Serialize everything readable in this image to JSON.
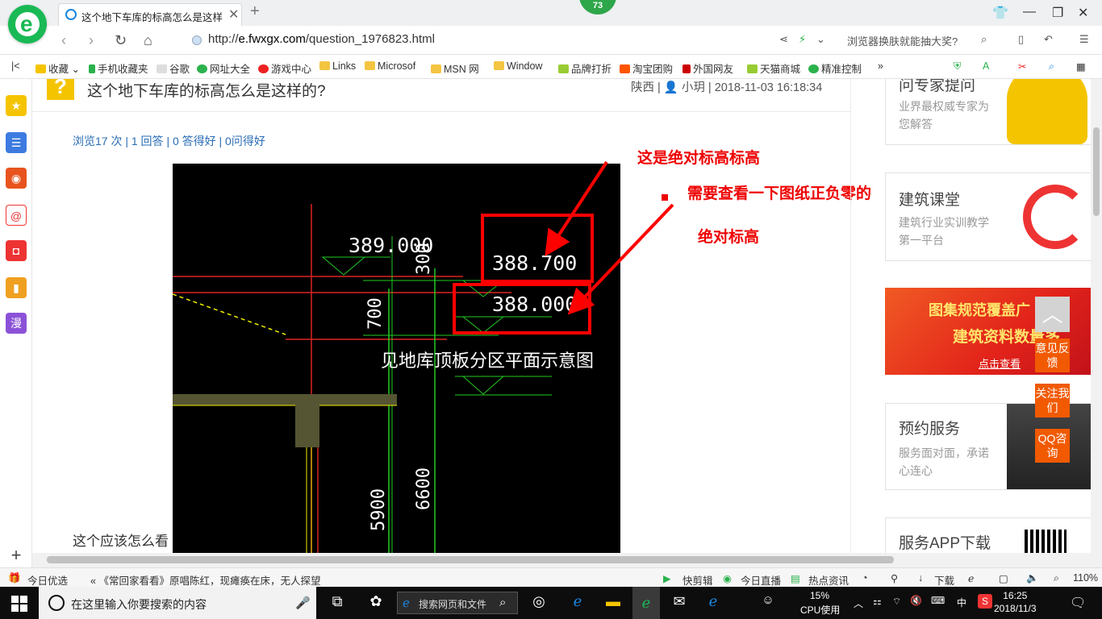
{
  "browser": {
    "tab_title": "这个地下车库的标高怎么是这样的",
    "badge": "73",
    "url_prefix": "http://",
    "url_host": "e.fwxgx.com",
    "url_path": "/question_1976823.html",
    "promo": "浏览器换肤就能抽大奖?"
  },
  "bookmarks": [
    {
      "label": "收藏"
    },
    {
      "label": "手机收藏夹"
    },
    {
      "label": "谷歌"
    },
    {
      "label": "网址大全"
    },
    {
      "label": "游戏中心"
    },
    {
      "label": "Links"
    },
    {
      "label": "Microsof"
    },
    {
      "label": "MSN 网"
    },
    {
      "label": "Window"
    },
    {
      "label": "品牌打折"
    },
    {
      "label": "淘宝团购"
    },
    {
      "label": "外国网友"
    },
    {
      "label": "天猫商城"
    },
    {
      "label": "精准控制"
    }
  ],
  "question": {
    "title": "这个地下车库的标高怎么是这样的?",
    "meta": "陕西 | 👤 小玥 | 2018-11-03 16:18:34",
    "stats": "浏览17 次 | 1 回答 | 0 答得好 | 0问得好",
    "body_start": "这个应该怎么看",
    "icon": "?"
  },
  "cad": {
    "elev1": "389.000",
    "elev2": "388.700",
    "elev3": "388.000",
    "dim1": "300",
    "dim2": "700",
    "dim3": "5900",
    "dim4": "6600",
    "note": "见地库顶板分区平面示意图"
  },
  "annotations": {
    "a1": "这是绝对标高标高",
    "a2": "需要查看一下图纸正负零的",
    "a3": "绝对标高"
  },
  "sidebar_right": {
    "card1_title": "问专家提问",
    "card1_sub": "业界最权威专家为您解答",
    "card2_title": "建筑课堂",
    "card2_sub": "建筑行业实训教学第一平台",
    "banner_l1": "图集规范覆盖广",
    "banner_l2": "建筑资料数量多",
    "banner_l3": "点击查看",
    "card3_title": "预约服务",
    "card3_sub": "服务面对面，承诺心连心",
    "card4_title": "服务APP下载",
    "float1": "意见反馈",
    "float2": "关注我们",
    "float3": "QQ咨询"
  },
  "statusbar": {
    "today": "今日优选",
    "news": "《常回家看看》原唱陈红，现瘫痪在床，无人探望",
    "s1": "快剪辑",
    "s2": "今日直播",
    "s3": "热点资讯",
    "s4": "下载",
    "zoom": "110%"
  },
  "taskbar": {
    "search_placeholder": "在这里输入你要搜索的内容",
    "web_search": "搜索网页和文件",
    "cpu": "15%",
    "cpu_label": "CPU使用",
    "ime": "中",
    "time": "16:25",
    "date": "2018/11/3",
    "notif": "1"
  }
}
